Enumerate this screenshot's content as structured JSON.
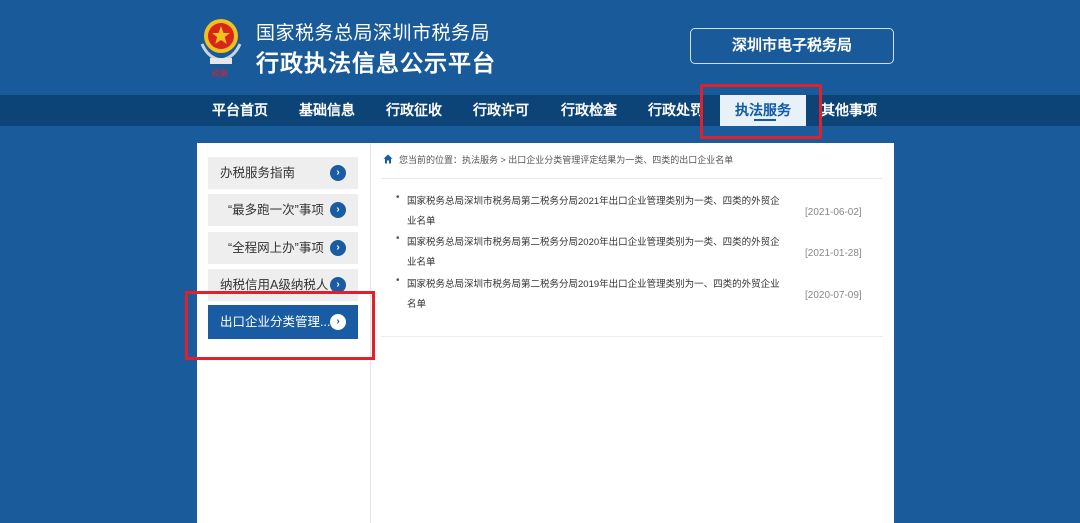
{
  "header": {
    "site_line1": "国家税务总局深圳市税务局",
    "site_line2": "行政执法信息公示平台",
    "e_tax_button": "深圳市电子税务局",
    "emblem_icon": "tax-emblem-icon"
  },
  "nav": {
    "items": [
      {
        "label": "平台首页"
      },
      {
        "label": "基础信息"
      },
      {
        "label": "行政征收"
      },
      {
        "label": "行政许可"
      },
      {
        "label": "行政检查"
      },
      {
        "label": "行政处罚"
      },
      {
        "label": "执法服务",
        "active": true
      },
      {
        "label": "其他事项"
      }
    ]
  },
  "sidebar": {
    "items": [
      {
        "label": "办税服务指南"
      },
      {
        "label": "“最多跑一次”事项"
      },
      {
        "label": "“全程网上办”事项"
      },
      {
        "label": "纳税信用A级纳税人"
      },
      {
        "label": "出口企业分类管理...",
        "active": true
      }
    ],
    "arrow_icon": "chevron-right-circle-icon"
  },
  "breadcrumb": {
    "text": "您当前的位置：执法服务 > 出口企业分类管理评定结果为一类、四类的出口企业名单",
    "icon": "home-icon"
  },
  "articles": [
    {
      "title": "国家税务总局深圳市税务局第二税务分局2021年出口企业管理类别为一类、四类的外贸企业名单",
      "date": "[2021-06-02]"
    },
    {
      "title": "国家税务总局深圳市税务局第二税务分局2020年出口企业管理类别为一类、四类的外贸企业名单",
      "date": "[2021-01-28]"
    },
    {
      "title": "国家税务总局深圳市税务局第二税务分局2019年出口企业管理类别为一、四类的外贸企业名单",
      "date": "[2020-07-09]"
    }
  ],
  "colors": {
    "primary": "#1a5ca3",
    "header_bg": "#195a9b",
    "nav_bg": "#0d4478",
    "highlight": "#e0202a"
  }
}
